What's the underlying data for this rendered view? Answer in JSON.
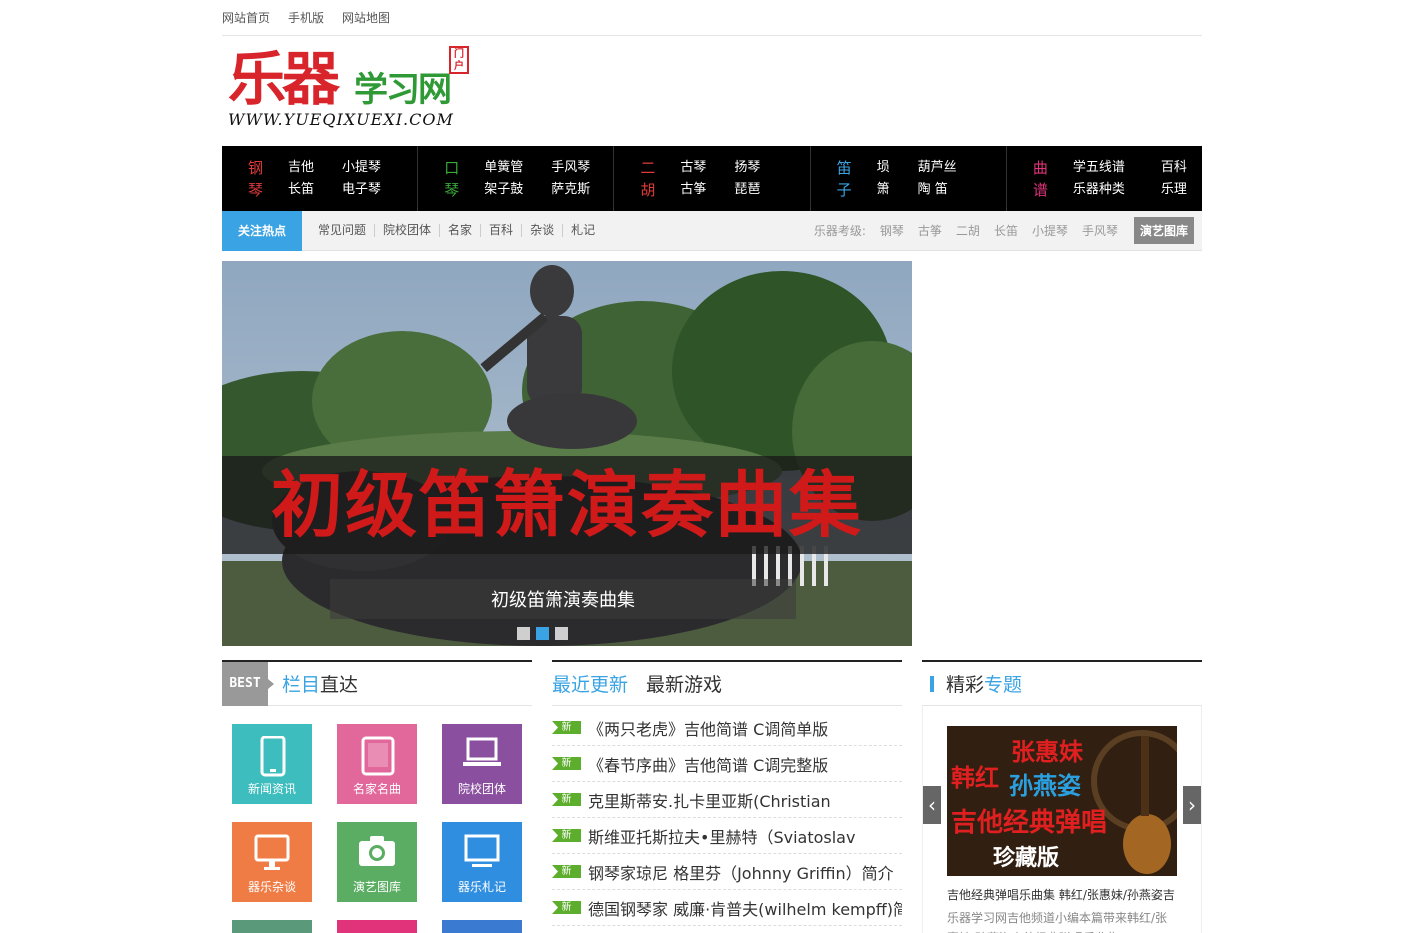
{
  "topbar": {
    "home": "网站首页",
    "mobile": "手机版",
    "sitemap": "网站地图"
  },
  "logo": {
    "main": "乐器",
    "sub": "学习网",
    "stamp": "门户",
    "url": "WWW.YUEQIXUEXI.COM"
  },
  "nav": [
    {
      "cat": [
        "钢",
        "琴"
      ],
      "cat_color": "#e03a3a",
      "links": [
        "吉他",
        "小提琴",
        "长笛",
        "电子琴"
      ]
    },
    {
      "cat": [
        "口",
        "琴"
      ],
      "cat_color": "#3aa83a",
      "links": [
        "单簧管",
        "手风琴",
        "架子鼓",
        "萨克斯"
      ]
    },
    {
      "cat": [
        "二",
        "胡"
      ],
      "cat_color": "#e03a3a",
      "links": [
        "古琴",
        "扬琴",
        "古筝",
        "琵琶"
      ]
    },
    {
      "cat": [
        "笛",
        "子"
      ],
      "cat_color": "#3aa3e3",
      "links": [
        "埙",
        "葫芦丝",
        "箫",
        "陶 笛"
      ]
    },
    {
      "cat": [
        "曲",
        "谱"
      ],
      "cat_color": "#e0337a",
      "links": [
        "学五线谱",
        "百科",
        "乐器种类",
        "乐理"
      ]
    }
  ],
  "subnav": {
    "hot": "关注热点",
    "links": [
      "常见问题",
      "院校团体",
      "名家",
      "百科",
      "杂谈",
      "札记"
    ],
    "grade_label": "乐器考级:",
    "grades": [
      "钢琴",
      "古筝",
      "二胡",
      "长笛",
      "小提琴",
      "手风琴"
    ],
    "gallery_btn": "演艺图库"
  },
  "slider": {
    "banner_text": "初级笛箫演奏曲集",
    "caption": "初级笛箫演奏曲集",
    "active_dot": 2
  },
  "columns": {
    "best_badge": "BEST",
    "col1_title_a": "栏目",
    "col1_title_b": "直达",
    "col2_tab_a": "最近更新",
    "col2_tab_b": "最新游戏",
    "col3_title_a": "精彩",
    "col3_title_b": "专题"
  },
  "tiles": [
    {
      "label": "新闻资讯",
      "color": "#3dbdbd",
      "icon": "mobile-icon"
    },
    {
      "label": "名家名曲",
      "color": "#e2679b",
      "icon": "tablet-icon"
    },
    {
      "label": "院校团体",
      "color": "#8a4f9e",
      "icon": "laptop-icon"
    },
    {
      "label": "器乐杂谈",
      "color": "#f07c45",
      "icon": "monitor-icon"
    },
    {
      "label": "演艺图库",
      "color": "#5aad62",
      "icon": "camera-icon"
    },
    {
      "label": "器乐札记",
      "color": "#2f8ee0",
      "icon": "desktop-icon"
    }
  ],
  "tiles_partial_colors": [
    "#5a9a7a",
    "#e0337a",
    "#3a7ad0"
  ],
  "news": {
    "badge": "新",
    "items": [
      "《两只老虎》吉他简谱 C调简单版",
      "《春节序曲》吉他简谱 C调完整版",
      "克里斯蒂安.扎卡里亚斯(Christian",
      "斯维亚托斯拉夫•里赫特（Sviatoslav",
      "钢琴家琼尼 格里芬（Johnny Griffin）简介",
      "德国钢琴家 威廉·肯普夫(wilhelm kempff)简"
    ]
  },
  "feature": {
    "img_text": {
      "red_top": "张惠妹",
      "red_left": "韩红",
      "blue": "孙燕姿",
      "main": "吉他经典弹唱",
      "edition": "珍藏版"
    },
    "caption": "吉他经典弹唱乐曲集 韩红/张惠妹/孙燕姿吉",
    "desc": "乐器学习网吉他频道小编本篇带来韩红/张惠妹/孙燕姿吉他经典弹唱乐曲集"
  },
  "colors": {
    "accent": "#3aa3e3",
    "nav_bg": "#000000",
    "new_badge": "#5eae2e"
  }
}
